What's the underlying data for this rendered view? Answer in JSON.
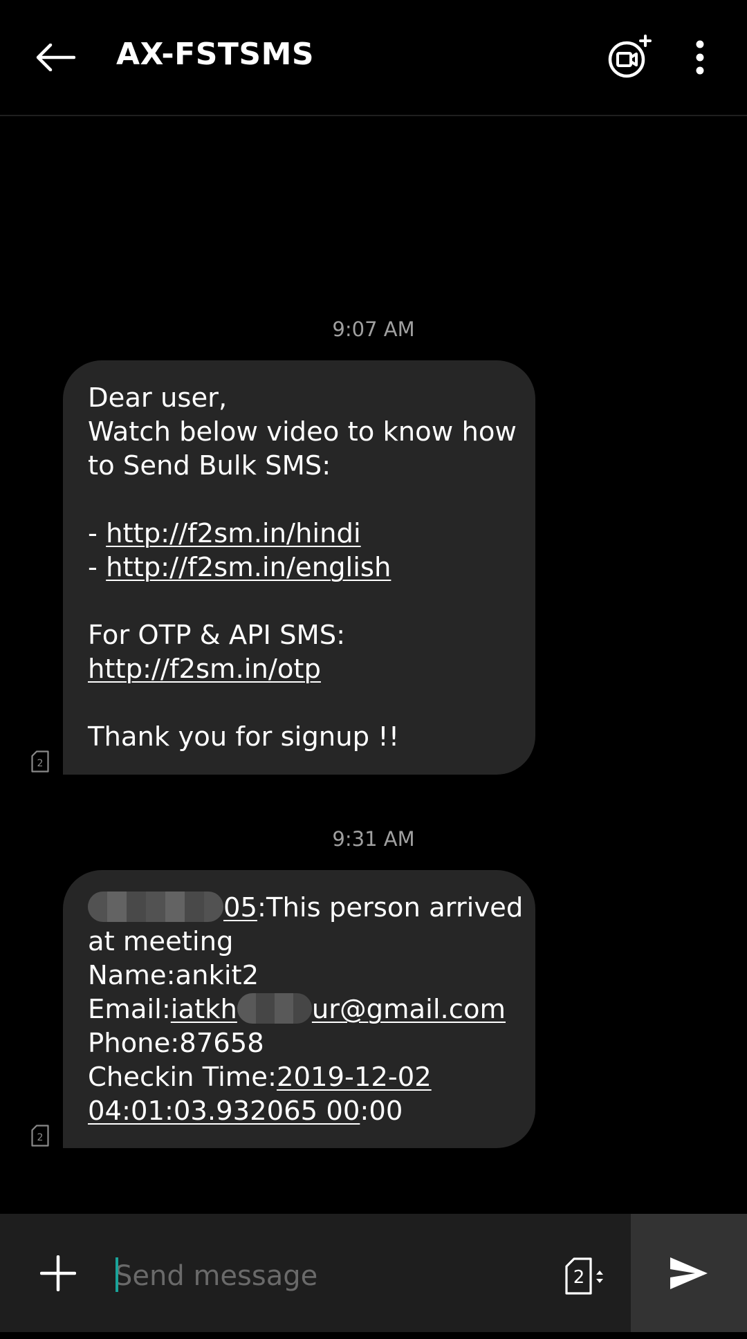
{
  "header": {
    "title": "AX-FSTSMS",
    "back_icon": "arrow-left-icon",
    "video_icon": "video-call-add-icon",
    "more_icon": "more-vertical-icon"
  },
  "messages": [
    {
      "timestamp": "9:07 AM",
      "sim": "2",
      "lines": {
        "l1": "Dear user,",
        "l2": "Watch below video to know how",
        "l3": "to Send Bulk SMS:",
        "l4_prefix": "- ",
        "l4_link": "http://f2sm.in/hindi",
        "l5_prefix": "- ",
        "l5_link": "http://f2sm.in/english",
        "l6": "For OTP & API SMS:",
        "l7_link": "http://f2sm.in/otp",
        "l8": "Thank you for signup !!"
      }
    },
    {
      "timestamp": "9:31 AM",
      "sim": "2",
      "lines": {
        "l1_link_tail": "05",
        "l1_rest": ":This person arrived",
        "l2": "at meeting",
        "l3": "Name:ankit2",
        "l4_label": "Email:",
        "l4_link_start": "iatkh",
        "l4_link_end": "ur@gmail.com",
        "l5": "Phone:87658",
        "l6_label": "Checkin Time:",
        "l6_link": "2019-12-02",
        "l7_link": "04:01:03.932065 00",
        "l7_rest": ":00"
      }
    }
  ],
  "composer": {
    "placeholder": "Send message",
    "sim_selected": "2",
    "add_icon": "plus-icon",
    "send_icon": "send-icon"
  },
  "colors": {
    "background": "#000000",
    "bubble": "#262626",
    "timestamp": "#a0a0a0",
    "composer": "#1e1e1e",
    "send_button": "#333333",
    "cursor_accent": "#1aa39a"
  }
}
